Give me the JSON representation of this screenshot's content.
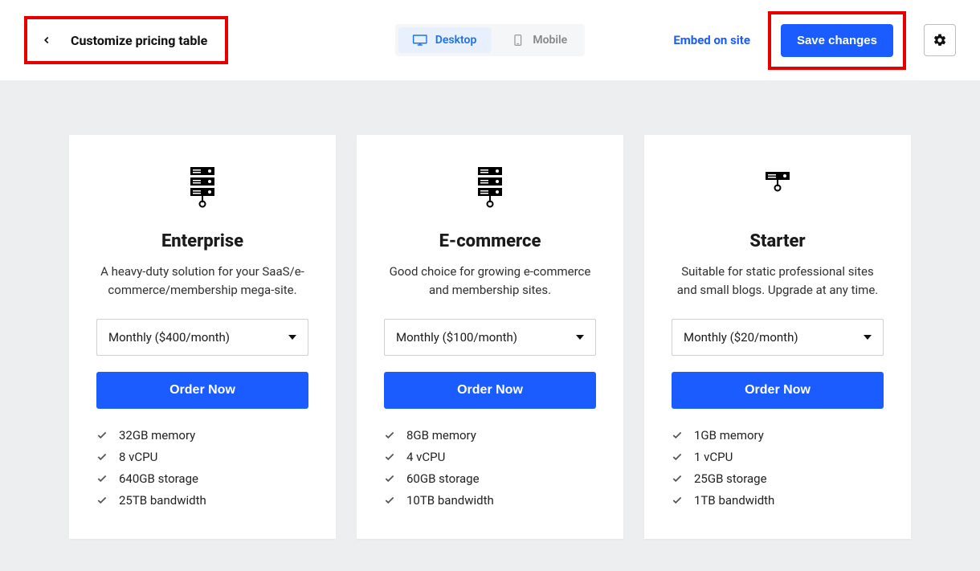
{
  "header": {
    "title": "Customize pricing table",
    "desktop_label": "Desktop",
    "mobile_label": "Mobile",
    "embed_label": "Embed on site",
    "save_label": "Save changes"
  },
  "plans": [
    {
      "name": "Enterprise",
      "desc": "A heavy-duty solution for your SaaS/e-commerce/membership mega-site.",
      "price_option": "Monthly ($400/month)",
      "cta": "Order Now",
      "features": [
        "32GB memory",
        "8 vCPU",
        "640GB storage",
        "25TB bandwidth"
      ]
    },
    {
      "name": "E-commerce",
      "desc": "Good choice for growing e-commerce and membership sites.",
      "price_option": "Monthly ($100/month)",
      "cta": "Order Now",
      "features": [
        "8GB memory",
        "4 vCPU",
        "60GB storage",
        "10TB bandwidth"
      ]
    },
    {
      "name": "Starter",
      "desc": "Suitable for static professional sites and small blogs. Upgrade at any time.",
      "price_option": "Monthly ($20/month)",
      "cta": "Order Now",
      "features": [
        "1GB memory",
        "1 vCPU",
        "25GB storage",
        "1TB bandwidth"
      ]
    }
  ]
}
